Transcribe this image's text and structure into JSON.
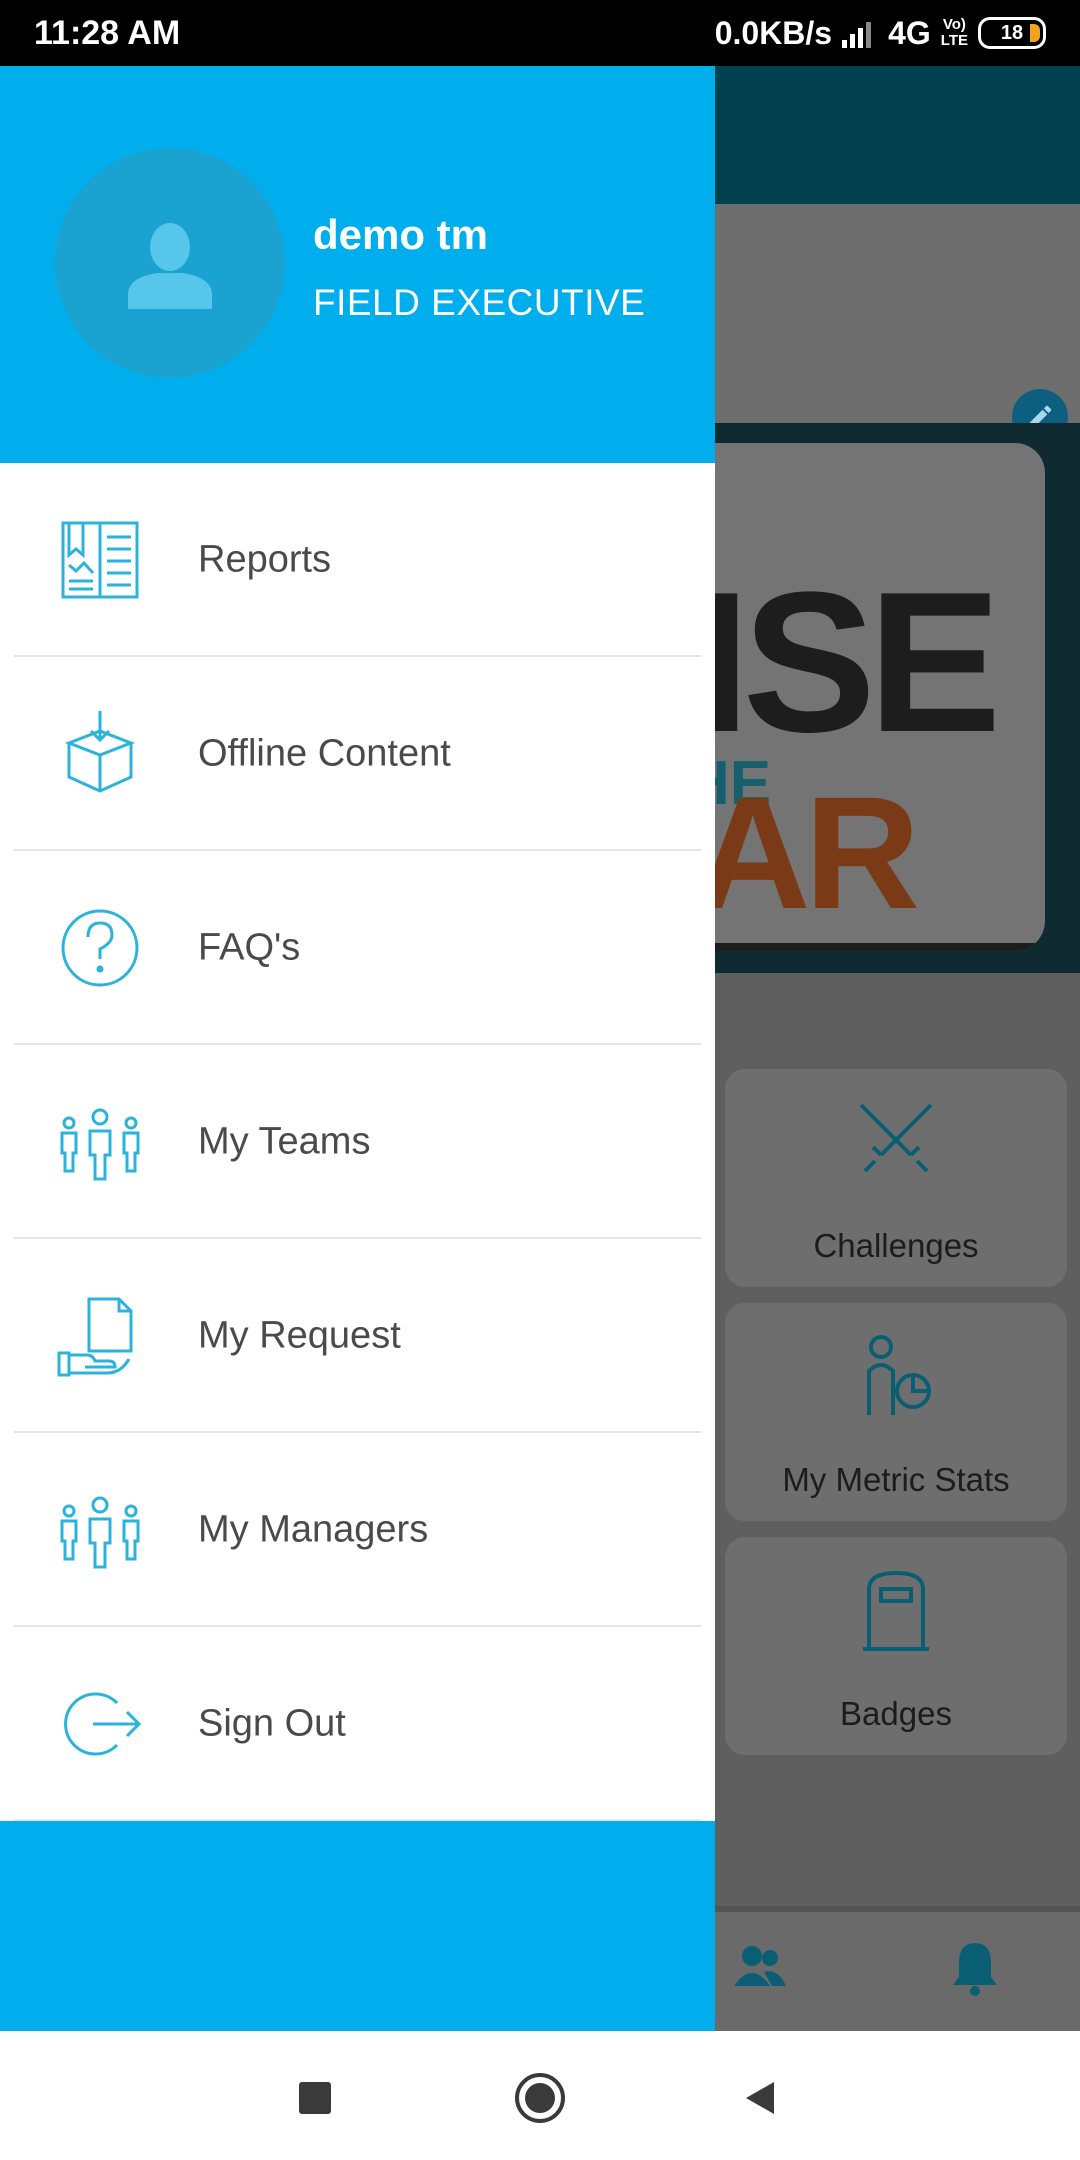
{
  "status_bar": {
    "time": "11:28 AM",
    "net_speed": "0.0KB/s",
    "network": "4G",
    "volte_top": "Vo)",
    "volte_bottom": "LTE",
    "battery": "18"
  },
  "drawer": {
    "user_name": "demo tm",
    "user_role": "FIELD EXECUTIVE",
    "items": [
      {
        "label": "Reports",
        "icon": "reports-icon"
      },
      {
        "label": "Offline Content",
        "icon": "offline-content-icon"
      },
      {
        "label": "FAQ's",
        "icon": "faq-icon"
      },
      {
        "label": "My Teams",
        "icon": "teams-icon"
      },
      {
        "label": "My Request",
        "icon": "request-icon"
      },
      {
        "label": "My Managers",
        "icon": "managers-icon"
      },
      {
        "label": "Sign Out",
        "icon": "sign-out-icon"
      }
    ]
  },
  "background": {
    "banner_line1": "ISE",
    "banner_line2": "HE",
    "banner_line3": "AR",
    "tiles": [
      {
        "label": "Challenges",
        "icon": "swords-icon"
      },
      {
        "label": "My Metric Stats",
        "icon": "metric-stats-icon"
      },
      {
        "label": "Badges",
        "icon": "badges-icon"
      }
    ]
  },
  "colors": {
    "accent": "#01aeed",
    "icon": "#2bb3dc",
    "text": "#4a4a4a"
  }
}
